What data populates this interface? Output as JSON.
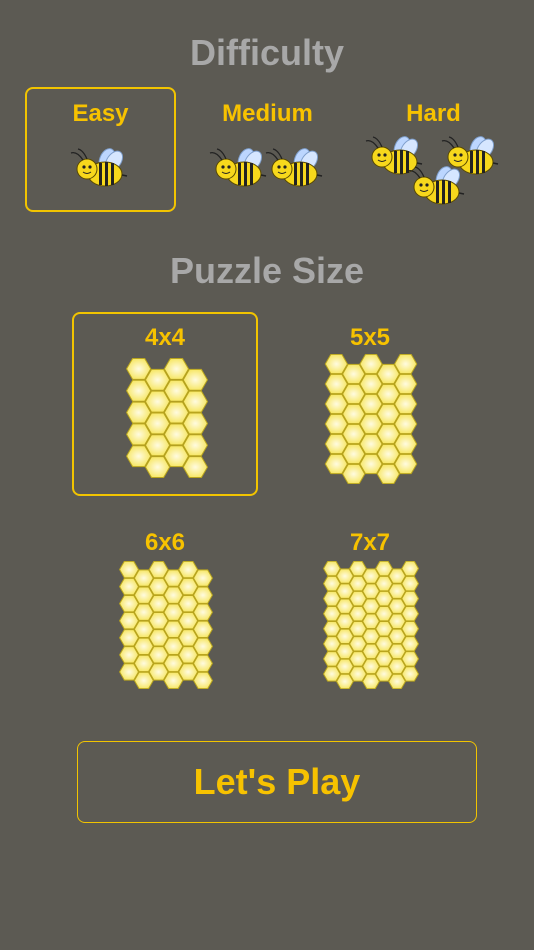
{
  "difficulty": {
    "title": "Difficulty",
    "options": [
      {
        "label": "Easy",
        "bees": 1,
        "selected": true
      },
      {
        "label": "Medium",
        "bees": 2,
        "selected": false
      },
      {
        "label": "Hard",
        "bees": 3,
        "selected": false
      }
    ]
  },
  "puzzle_size": {
    "title": "Puzzle Size",
    "options": [
      {
        "label": "4x4",
        "n": 4,
        "selected": true
      },
      {
        "label": "5x5",
        "n": 5,
        "selected": false
      },
      {
        "label": "6x6",
        "n": 6,
        "selected": false
      },
      {
        "label": "7x7",
        "n": 7,
        "selected": false
      }
    ]
  },
  "play_button": {
    "label": "Let's Play"
  },
  "colors": {
    "background": "#5c5a53",
    "accent": "#f7c200",
    "heading": "#a8a8a8",
    "hex_fill": "#fbf07a",
    "hex_stroke": "#b9a51e"
  }
}
